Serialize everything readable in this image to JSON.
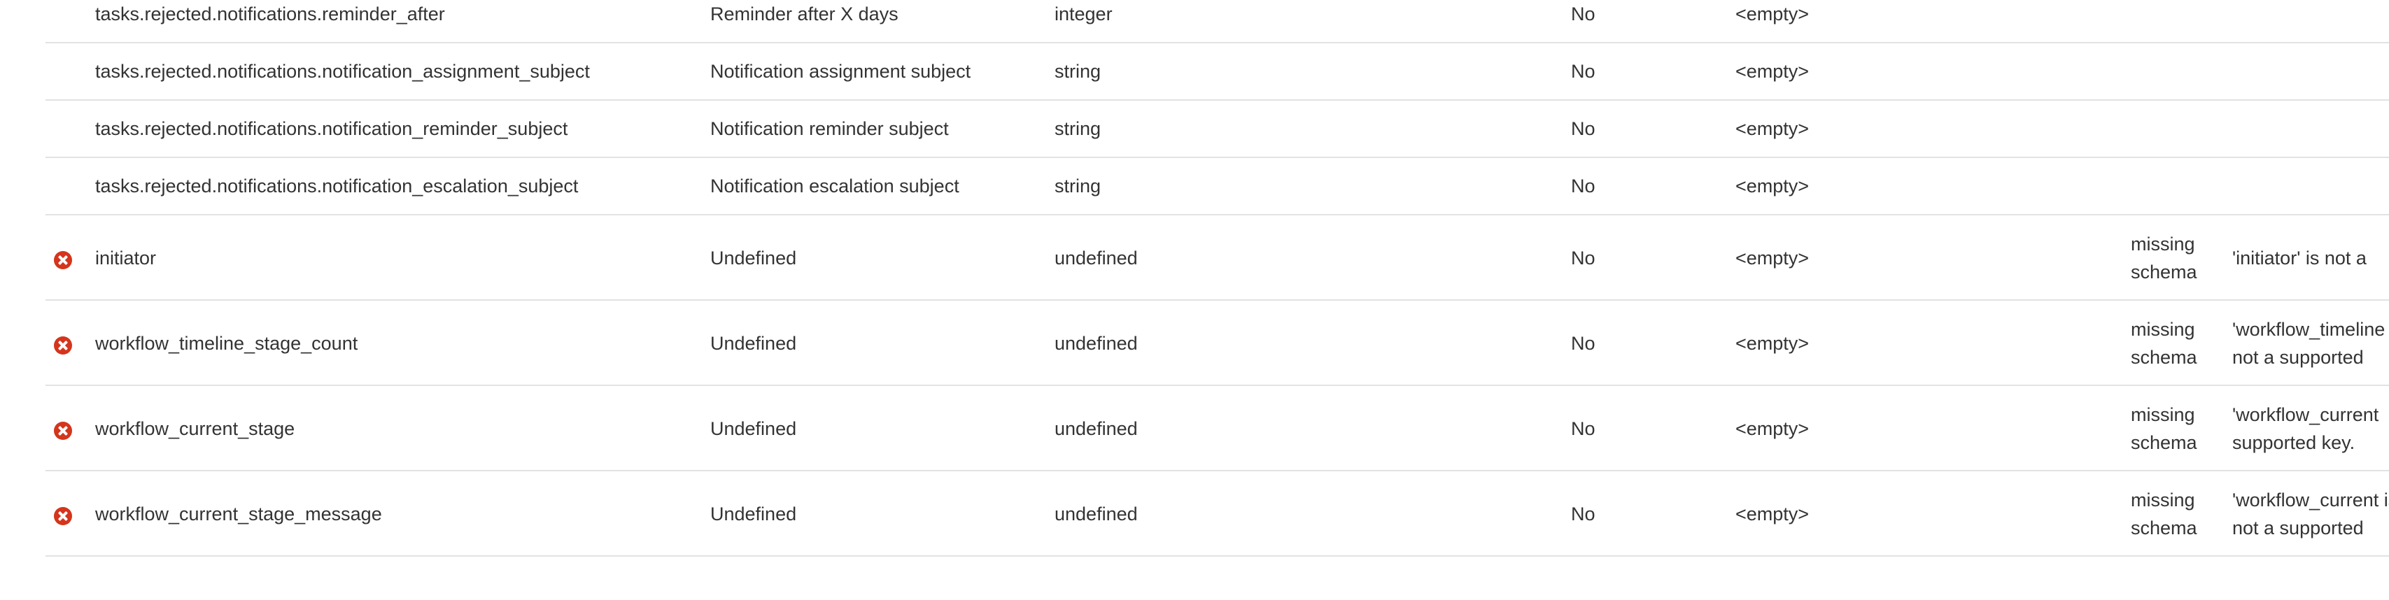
{
  "colors": {
    "error": "#d4351c",
    "text": "#333333",
    "divider": "#e2e2e2"
  },
  "rows": [
    {
      "key": "tasks.rejected.notifications.reminder_after",
      "label": "Reminder after X days",
      "type": "integer",
      "required": "No",
      "default": "<empty>"
    },
    {
      "key": "tasks.rejected.notifications.notification_assignment_subject",
      "label": "Notification assignment subject",
      "type": "string",
      "required": "No",
      "default": "<empty>"
    },
    {
      "key": "tasks.rejected.notifications.notification_reminder_subject",
      "label": "Notification reminder subject",
      "type": "string",
      "required": "No",
      "default": "<empty>"
    },
    {
      "key": "tasks.rejected.notifications.notification_escalation_subject",
      "label": "Notification escalation subject",
      "type": "string",
      "required": "No",
      "default": "<empty>"
    },
    {
      "key": "initiator",
      "label": "Undefined",
      "type": "undefined",
      "required": "No",
      "default": "<empty>",
      "status": "missing schema",
      "message": "'initiator' is not a",
      "icon": "error-circle-icon"
    },
    {
      "key": "workflow_timeline_stage_count",
      "label": "Undefined",
      "type": "undefined",
      "required": "No",
      "default": "<empty>",
      "status": "missing schema",
      "message": "'workflow_timeline is not a supported",
      "icon": "error-circle-icon"
    },
    {
      "key": "workflow_current_stage",
      "label": "Undefined",
      "type": "undefined",
      "required": "No",
      "default": "<empty>",
      "status": "missing schema",
      "message": "'workflow_current supported key.",
      "icon": "error-circle-icon"
    },
    {
      "key": "workflow_current_stage_message",
      "label": "Undefined",
      "type": "undefined",
      "required": "No",
      "default": "<empty>",
      "status": "missing schema",
      "message": "'workflow_current is not a supported",
      "icon": "error-circle-icon"
    }
  ]
}
